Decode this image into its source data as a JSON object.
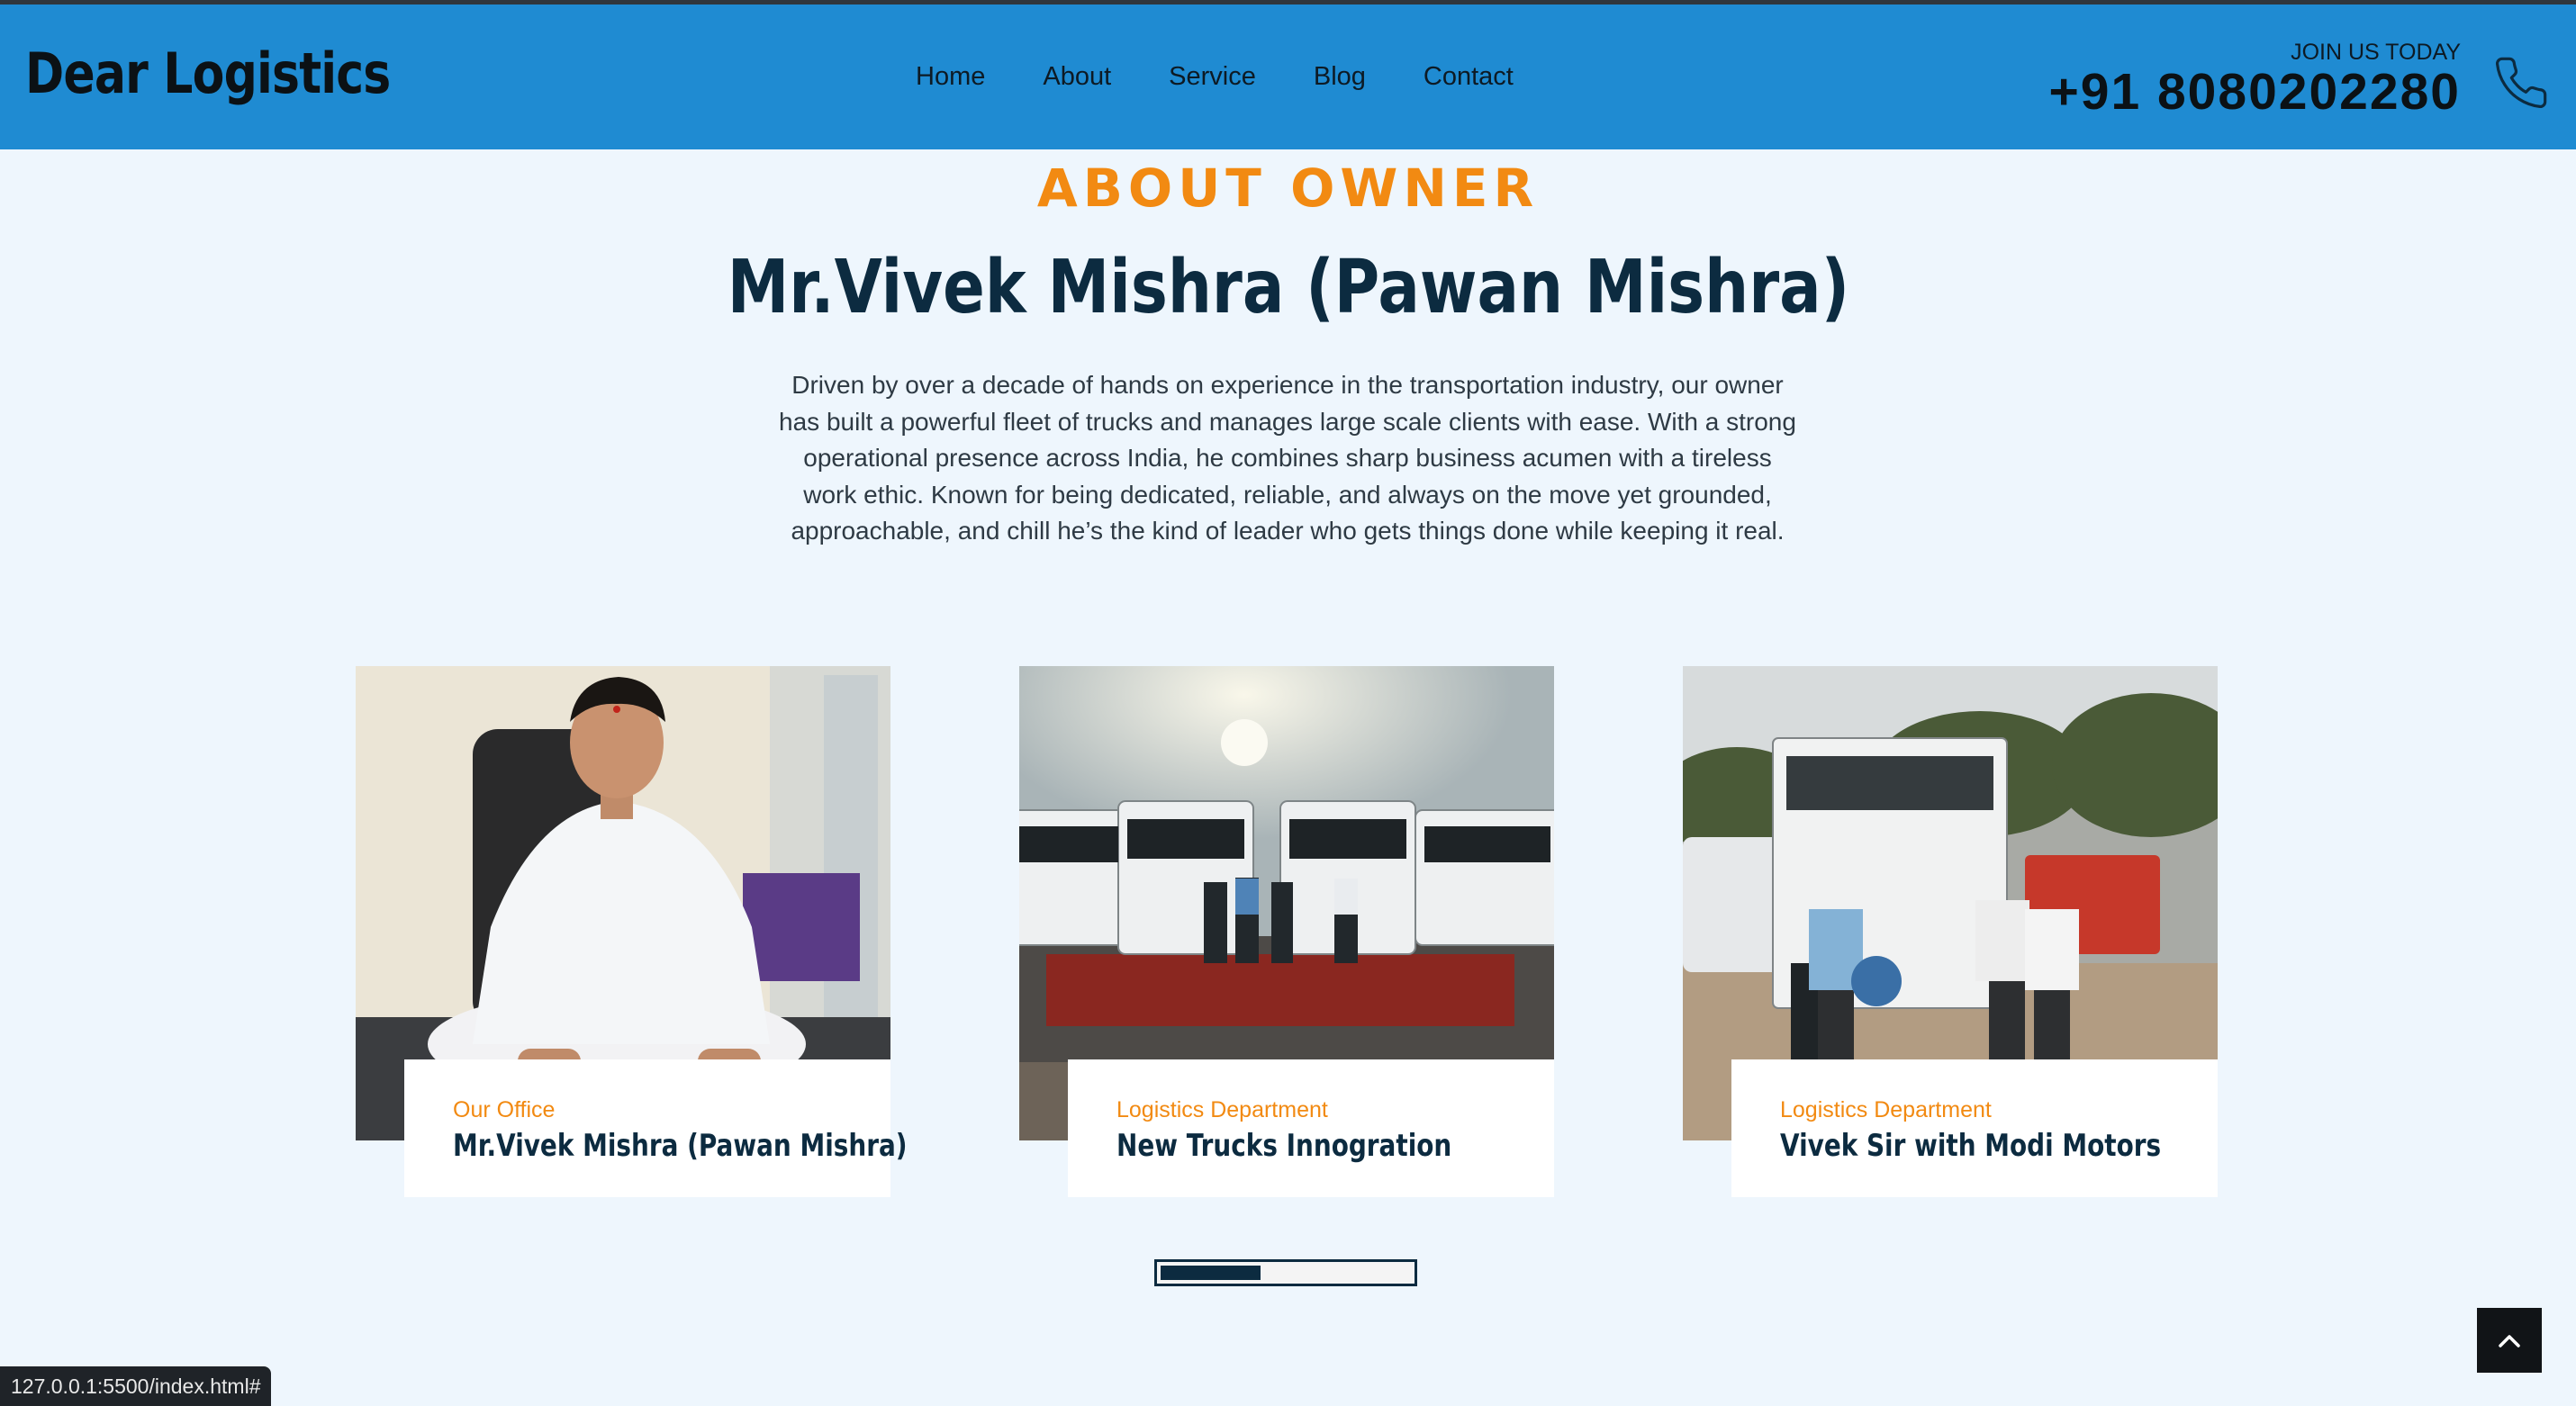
{
  "header": {
    "brand": "Dear Logistics",
    "nav": [
      "Home",
      "About",
      "Service",
      "Blog",
      "Contact"
    ],
    "join_label": "JOIN US TODAY",
    "phone": "+91 8080202280"
  },
  "about": {
    "eyebrow": "ABOUT OWNER",
    "title": "Mr.Vivek Mishra (Pawan Mishra)",
    "bio": "Driven by over a decade of hands on experience in the transportation industry, our owner has built a powerful fleet of trucks and manages large scale clients with ease. With a strong operational presence across India, he combines sharp business acumen with a tireless work ethic. Known for being dedicated, reliable, and always on the move yet grounded, approachable, and chill he’s the kind of leader who gets things done while keeping it real."
  },
  "cards": [
    {
      "category": "Our Office",
      "title": "Mr.Vivek Mishra (Pawan Mishra)"
    },
    {
      "category": "Logistics Department",
      "title": "New Trucks Innogration"
    },
    {
      "category": "Logistics Department",
      "title": "Vivek Sir with Modi Motors"
    }
  ],
  "carousel": {
    "progress": 0.4
  },
  "status_url": "127.0.0.1:5500/index.html#",
  "colors": {
    "header": "#1f8bd2",
    "accent": "#f28a12",
    "navy": "#0c2b40",
    "page": "#eef6fd"
  },
  "icons": {
    "phone": "phone-icon",
    "back_to_top": "chevron-up-icon"
  }
}
